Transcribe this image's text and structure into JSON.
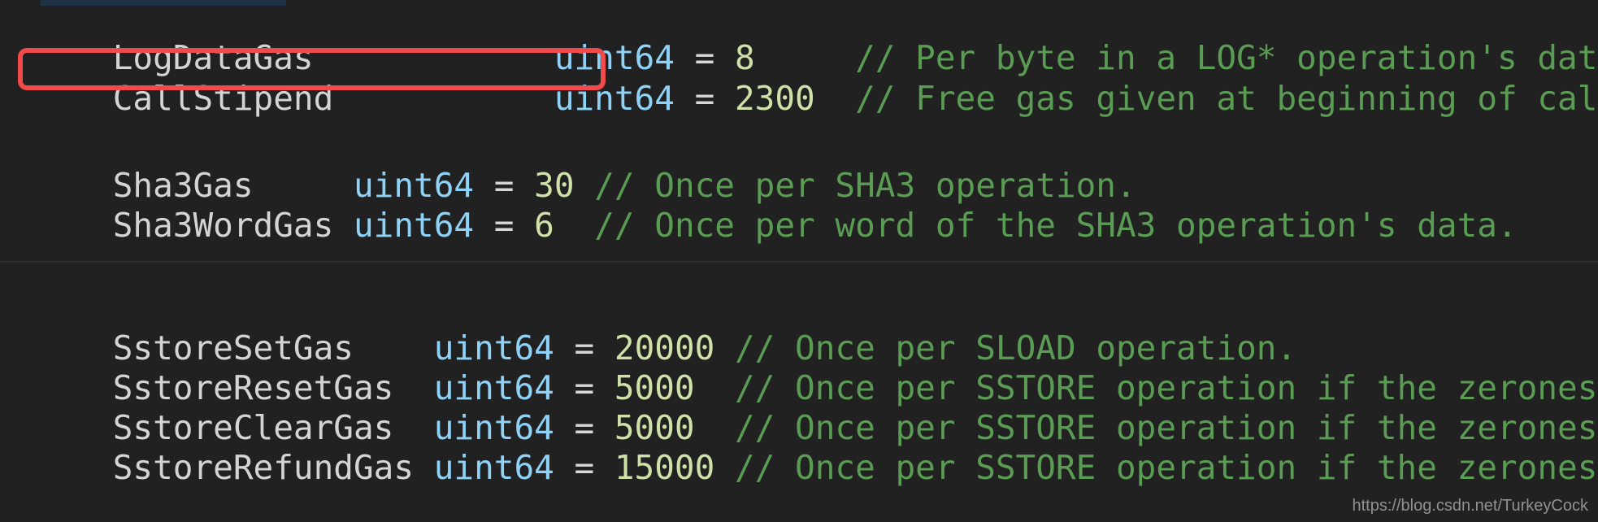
{
  "editor": {
    "background_color": "#212121",
    "selection_strip_color": "#1d3244",
    "separator_color": "#2e2e2e"
  },
  "theme": {
    "identifier_color": "#d4d4d4",
    "type_color": "#8ed3f7",
    "operator_color": "#d8d8d8",
    "number_color": "#cfe0a8",
    "comment_color": "#5a9c53",
    "highlight_color": "#f04a4a"
  },
  "annotation": {
    "highlight_target": "CallStipend",
    "shape": "rounded-rectangle",
    "color": "#f04a4a"
  },
  "watermark": {
    "text": "https://blog.csdn.net/TurkeyCock"
  },
  "code": {
    "blocks": [
      {
        "name": "log-gas-block",
        "lines": [
          {
            "name": "log-data-gas",
            "identifier": "LogDataGas",
            "gap_after_identifier": "            ",
            "type": "uint64",
            "operator": " = ",
            "value": "8",
            "gap_before_comment": "     ",
            "comment": "// Per byte in a LOG* operation's data."
          },
          {
            "name": "call-stipend",
            "identifier": "CallStipend",
            "gap_after_identifier": "           ",
            "type": "uint64",
            "operator": " = ",
            "value": "2300",
            "gap_before_comment": "  ",
            "comment": "// Free gas given at beginning of call."
          }
        ]
      },
      {
        "name": "sha3-gas-block",
        "lines": [
          {
            "name": "sha3-gas",
            "identifier": "Sha3Gas",
            "gap_after_identifier": "     ",
            "type": "uint64",
            "operator": " = ",
            "value": "30",
            "gap_before_comment": " ",
            "comment": "// Once per SHA3 operation."
          },
          {
            "name": "sha3-word-gas",
            "identifier": "Sha3WordGas",
            "gap_after_identifier": " ",
            "type": "uint64",
            "operator": " = ",
            "value": "6",
            "gap_before_comment": "  ",
            "comment": "// Once per word of the SHA3 operation's data."
          }
        ]
      },
      {
        "name": "sstore-gas-block",
        "lines": [
          {
            "name": "sstore-set-gas",
            "identifier": "SstoreSetGas",
            "gap_after_identifier": "    ",
            "type": "uint64",
            "operator": " = ",
            "value": "20000",
            "gap_before_comment": " ",
            "comment": "// Once per SLOAD operation."
          },
          {
            "name": "sstore-reset-gas",
            "identifier": "SstoreResetGas",
            "gap_after_identifier": "  ",
            "type": "uint64",
            "operator": " = ",
            "value": "5000",
            "gap_before_comment": "  ",
            "comment": "// Once per SSTORE operation if the zeroness c"
          },
          {
            "name": "sstore-clear-gas",
            "identifier": "SstoreClearGas",
            "gap_after_identifier": "  ",
            "type": "uint64",
            "operator": " = ",
            "value": "5000",
            "gap_before_comment": "  ",
            "comment": "// Once per SSTORE operation if the zeroness c"
          },
          {
            "name": "sstore-refund-gas",
            "identifier": "SstoreRefundGas",
            "gap_after_identifier": " ",
            "type": "uint64",
            "operator": " = ",
            "value": "15000",
            "gap_before_comment": " ",
            "comment": "// Once per SSTORE operation if the zeroness c"
          }
        ]
      }
    ]
  }
}
